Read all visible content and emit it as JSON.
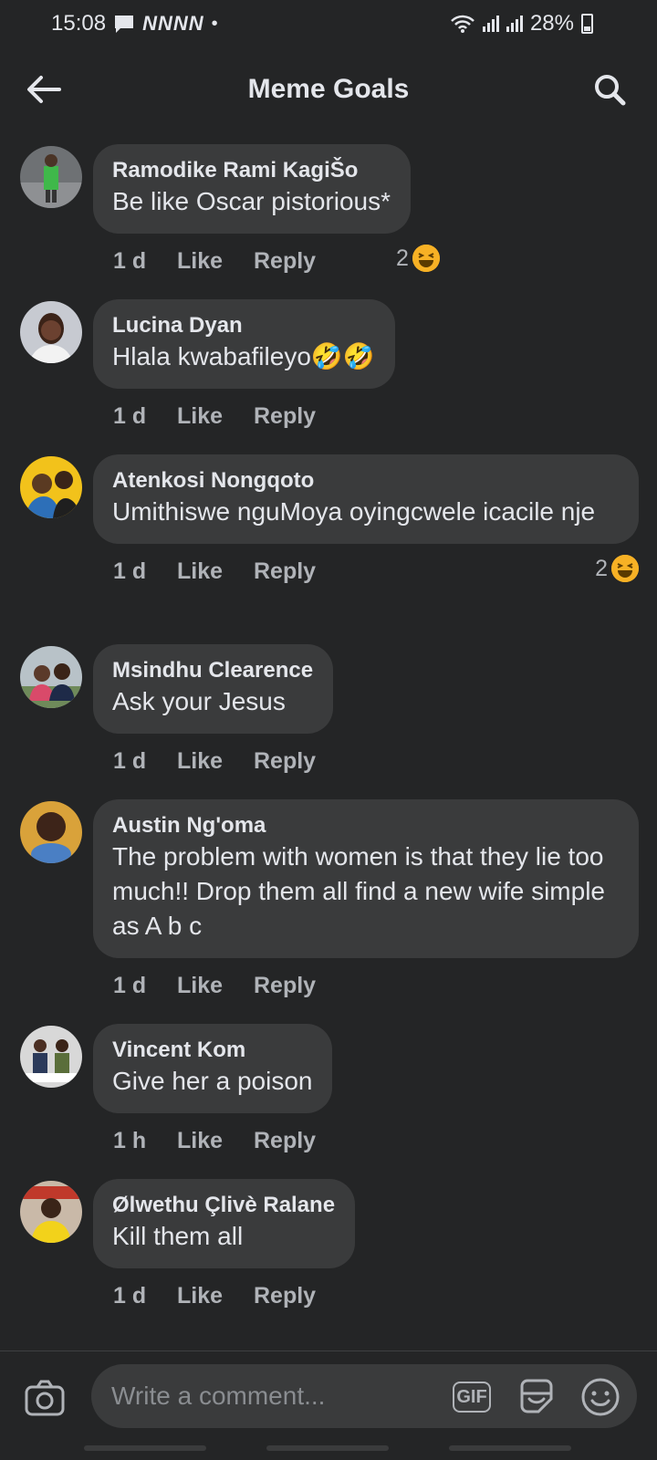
{
  "status": {
    "time": "15:08",
    "notif": "NNNN",
    "battery": "28%"
  },
  "header": {
    "title": "Meme Goals"
  },
  "comments": [
    {
      "author": "Ramodike Rami KagiŠo",
      "text": "Be like Oscar pistorious*",
      "time": "1 d",
      "like": "Like",
      "reply": "Reply",
      "reaction_count": "2"
    },
    {
      "author": "Lucina Dyan",
      "text": "Hlala kwabafileyo🤣🤣",
      "time": "1 d",
      "like": "Like",
      "reply": "Reply"
    },
    {
      "author": "Atenkosi Nongqoto",
      "text": "Umithiswe nguMoya oyingcwele icacile nje",
      "time": "1 d",
      "like": "Like",
      "reply": "Reply",
      "reaction_count": "2"
    },
    {
      "author": "Msindhu Clearence",
      "text": "Ask your Jesus",
      "time": "1 d",
      "like": "Like",
      "reply": "Reply"
    },
    {
      "author": "Austin Ng'oma",
      "text": "The problem  with women  is that they lie too much!!  Drop them all find a new wife simple as A b c",
      "time": "1 d",
      "like": "Like",
      "reply": "Reply"
    },
    {
      "author": "Vincent Kom",
      "text": "Give her a poison",
      "time": "1 h",
      "like": "Like",
      "reply": "Reply"
    },
    {
      "author": "Ølwethu Çlivè Ralane",
      "text": "Kill them all",
      "time": "1 d",
      "like": "Like",
      "reply": "Reply"
    }
  ],
  "composer": {
    "placeholder": "Write a comment...",
    "gif_label": "GIF"
  },
  "colors": {
    "background": "#242526",
    "bubble": "#3a3b3c",
    "text": "#e4e6eb",
    "muted": "#b0b3b8",
    "reaction": "#f7b125"
  }
}
